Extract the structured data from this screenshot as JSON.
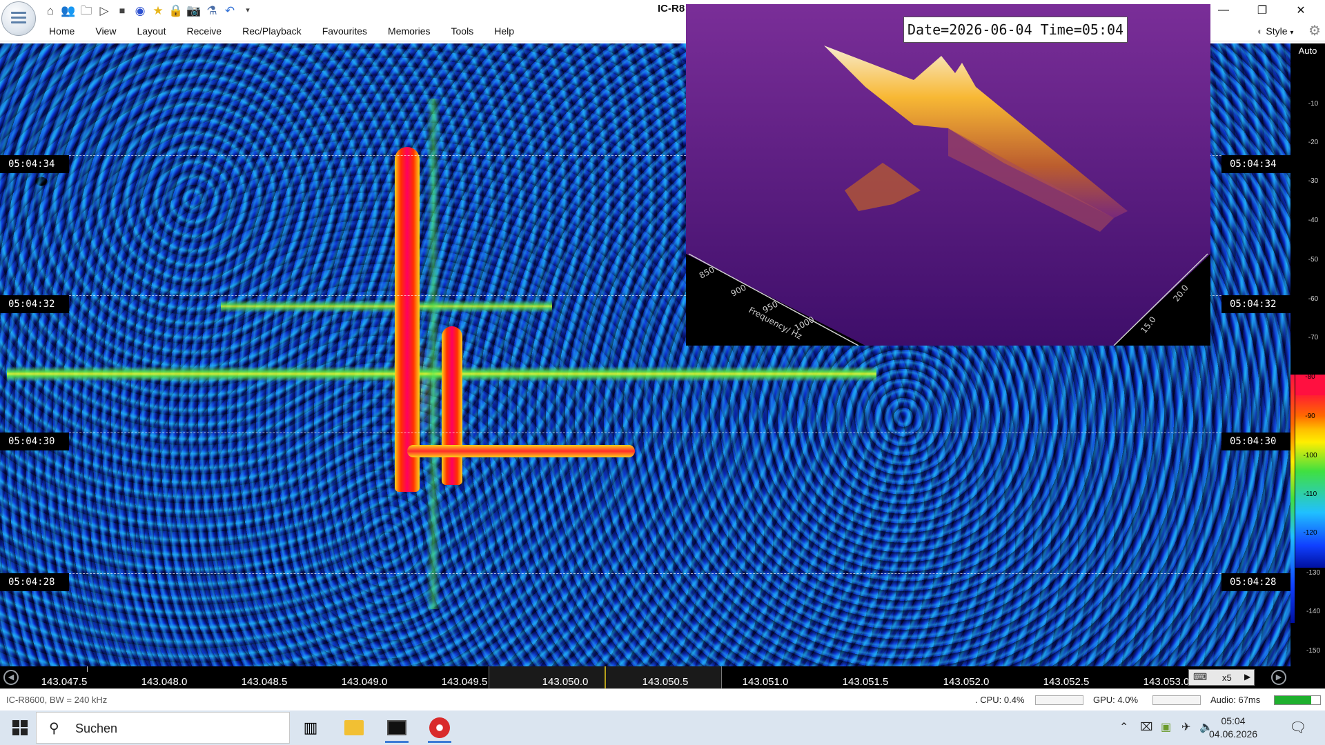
{
  "window": {
    "title": "IC-R8",
    "minimize_icon": "minimize-icon",
    "maximize_icon": "restore-icon",
    "close_icon": "close-icon"
  },
  "quick_access": [
    "home-icon",
    "users-icon",
    "folder-icon",
    "play-icon",
    "stop-icon",
    "record-icon",
    "favourite-star-icon",
    "lock-icon",
    "camera-icon",
    "flask-icon",
    "undo-icon",
    "customize-dropdown-icon"
  ],
  "menu": {
    "items": [
      "Home",
      "View",
      "Layout",
      "Receive",
      "Rec/Playback",
      "Favourites",
      "Memories",
      "Tools",
      "Help"
    ],
    "style_label": "Style"
  },
  "waterfall": {
    "time_markers": [
      "05:04:34",
      "05:04:32",
      "05:04:30",
      "05:04:28"
    ]
  },
  "overlay": {
    "timestamp": "Date=2026-06-04 Time=05:04",
    "freq_axis_title": "Frequency/ Hz",
    "freq_ticks": [
      "850",
      "900",
      "950",
      "1000"
    ],
    "time_ticks": [
      "15.0",
      "20.0"
    ]
  },
  "scale": {
    "auto_label": "Auto",
    "ticks": [
      "-10",
      "-20",
      "-30",
      "-40",
      "-50",
      "-60",
      "-70",
      "-80",
      "-90",
      "-100",
      "-110",
      "-120",
      "-130",
      "-140",
      "-150"
    ],
    "colors": {
      "red": "#ff1040",
      "orange": "#ff6a00",
      "yellow": "#ffee00",
      "green": "#40e040",
      "cyan": "#20c0ff",
      "blue": "#1040ff"
    }
  },
  "frequency_axis": {
    "labels": [
      "143.047.5",
      "143.048.0",
      "143.048.5",
      "143.049.0",
      "143.049.5",
      "143.050.0",
      "143.050.5",
      "143.051.0",
      "143.051.5",
      "143.052.0",
      "143.052.5",
      "143.053.0"
    ],
    "zoom": "x5"
  },
  "status": {
    "radio": "IC-R8600, BW = 240 kHz",
    "cpu": ". CPU: 0.4%",
    "gpu": "GPU: 4.0%",
    "audio": "Audio: 67ms",
    "audio_level_pct": 80
  },
  "taskbar": {
    "search_placeholder": "Suchen",
    "time": "05:04",
    "date": "04.06.2026"
  }
}
